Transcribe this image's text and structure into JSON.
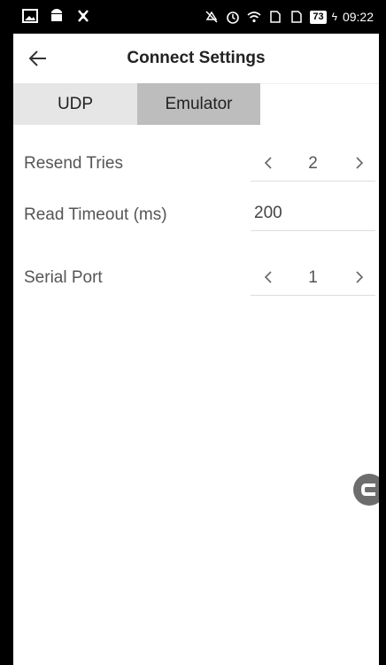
{
  "status_bar": {
    "time": "09:22",
    "battery_level": "73",
    "icons_left": [
      "image-icon",
      "android-icon",
      "bug-icon"
    ],
    "icons_right": [
      "mute-icon",
      "alarm-icon",
      "wifi-icon",
      "sim1-icon",
      "sim2-icon",
      "battery-icon",
      "charging-icon"
    ]
  },
  "app_bar": {
    "title": "Connect Settings",
    "back_icon": "arrow-left-icon"
  },
  "tabs": [
    {
      "label": "UDP",
      "selected": false
    },
    {
      "label": "Emulator",
      "selected": true
    }
  ],
  "settings": {
    "resend_tries": {
      "label": "Resend Tries",
      "value": "2"
    },
    "read_timeout": {
      "label": "Read Timeout (ms)",
      "value": "200"
    },
    "serial_port": {
      "label": "Serial Port",
      "value": "1"
    }
  },
  "fab": {
    "icon": "c-logo-icon"
  },
  "colors": {
    "status_bar_bg": "#000000",
    "tab_bg": "#e6e6e6",
    "tab_selected_bg": "#bdbdbd",
    "label_text": "#555555"
  }
}
